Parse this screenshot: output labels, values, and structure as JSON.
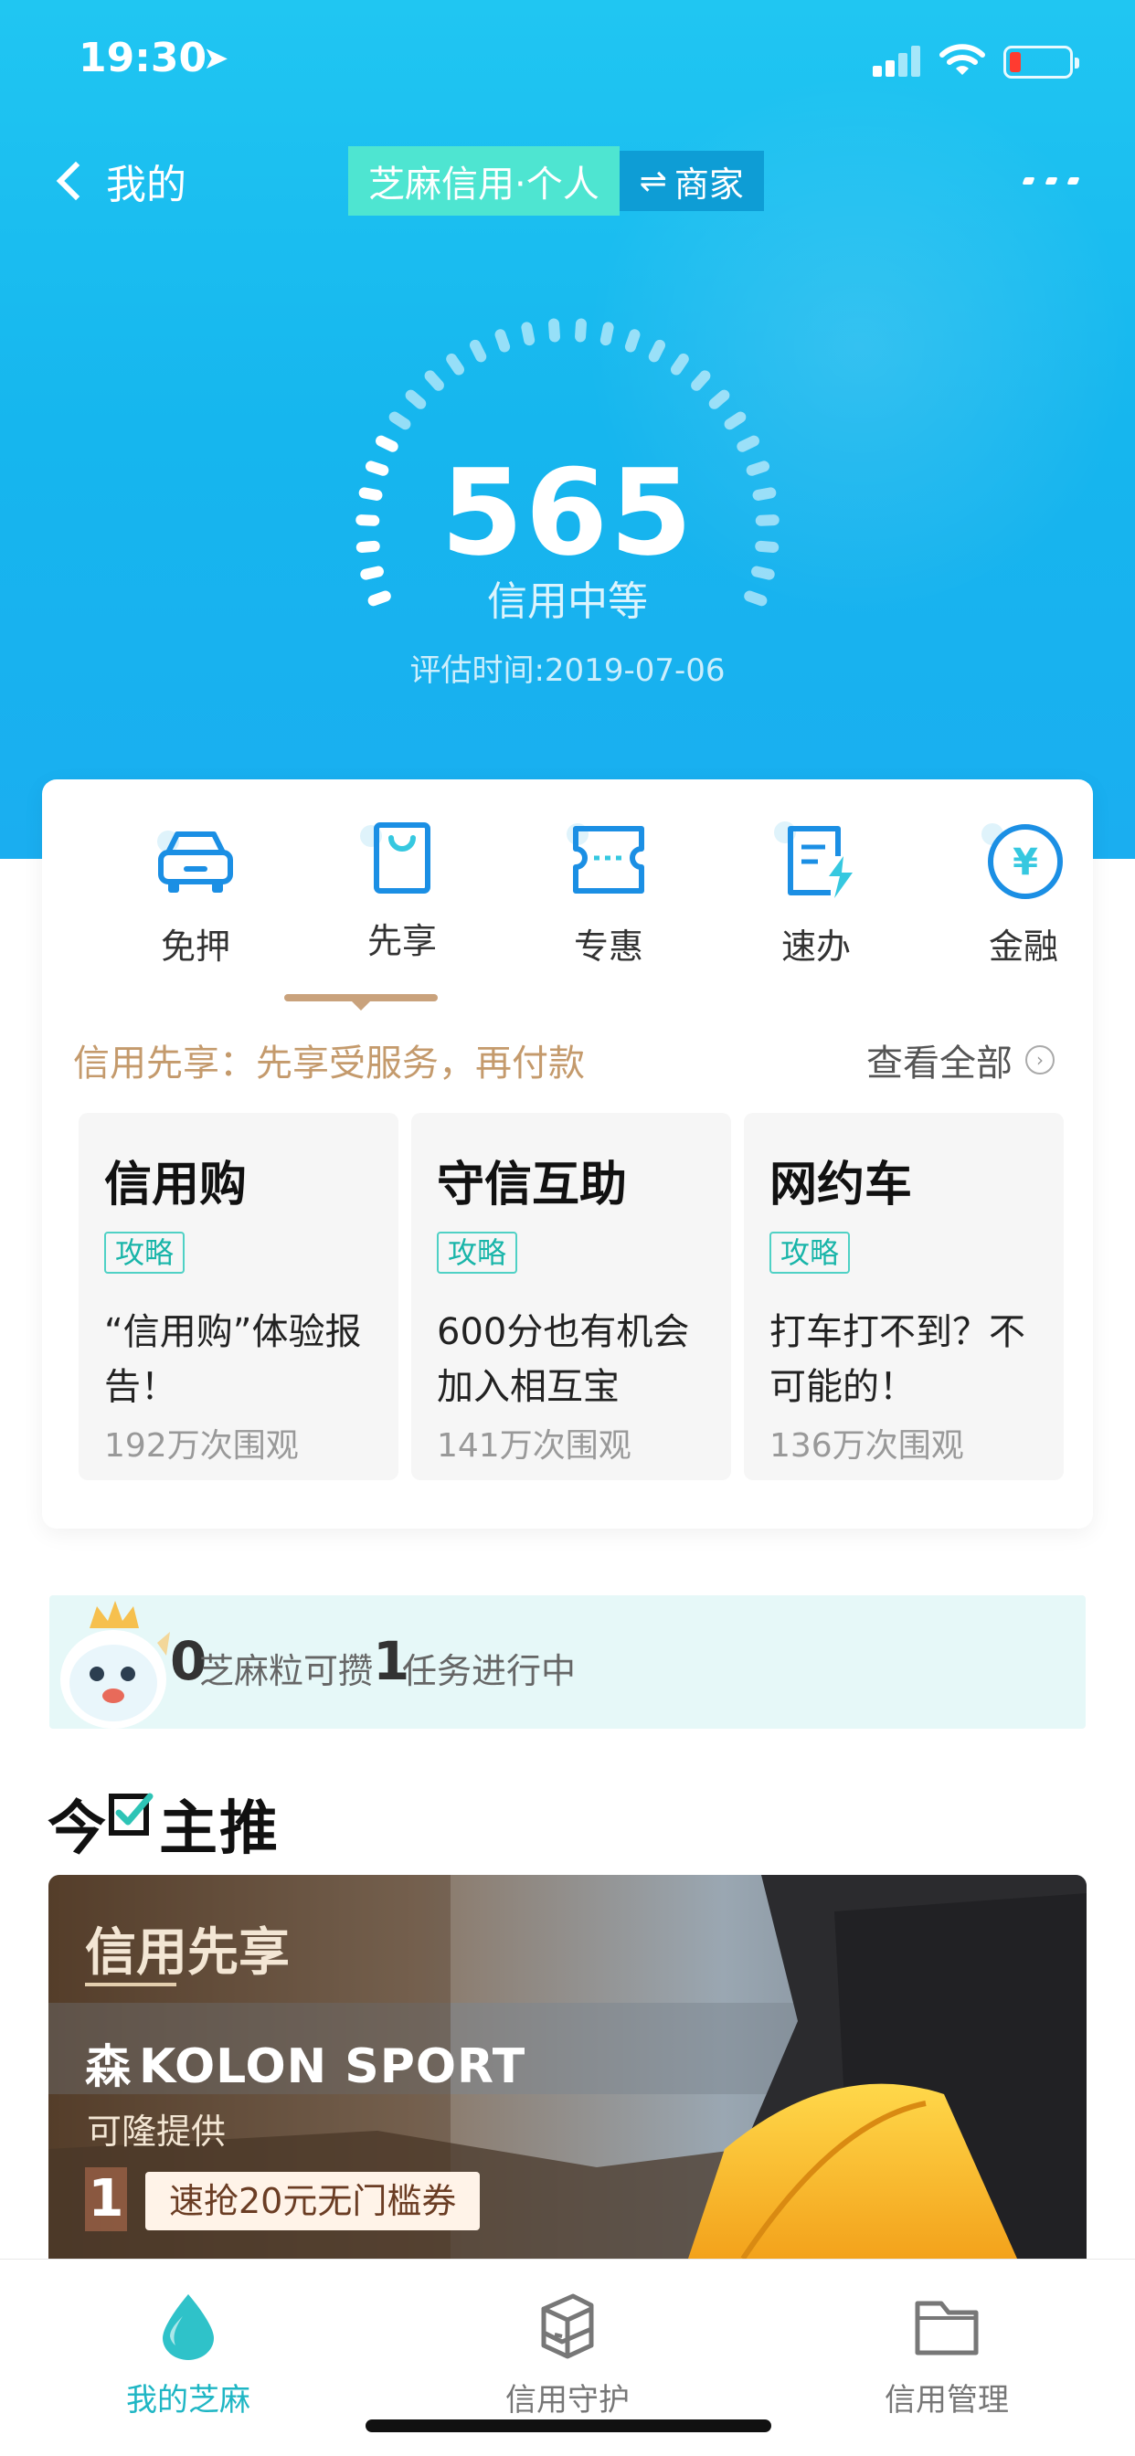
{
  "status_bar": {
    "time": "19:30"
  },
  "nav": {
    "back_label": "我的",
    "current_mode": "芝麻信用·个人",
    "switch_label": "商家"
  },
  "score": {
    "value": "565",
    "level": "信用中等",
    "eval_time": "评估时间:2019-07-06"
  },
  "service_tabs": [
    {
      "label": "免押",
      "icon": "car-icon"
    },
    {
      "label": "先享",
      "icon": "shopping-bag-icon"
    },
    {
      "label": "专惠",
      "icon": "coupon-icon"
    },
    {
      "label": "速办",
      "icon": "fast-document-icon"
    },
    {
      "label": "金融",
      "icon": "yuan-coin-icon"
    }
  ],
  "active_tab": "先享",
  "section": {
    "desc": "信用先享：先享受服务，再付款",
    "view_all": "查看全部"
  },
  "cards": [
    {
      "title": "信用购",
      "tag": "攻略",
      "desc": "“信用购”体验报告！",
      "views": "192万次围观"
    },
    {
      "title": "守信互助",
      "tag": "攻略",
      "desc": "600分也有机会加入相互宝",
      "views": "141万次围观"
    },
    {
      "title": "网约车",
      "tag": "攻略",
      "desc": "打车打不到？不可能的！",
      "views": "136万次围观"
    }
  ],
  "tasks": {
    "sesame_count": "0",
    "sesame_label": "芝麻粒可攒",
    "task_count": "1",
    "task_label": "任务进行中"
  },
  "today": {
    "title_a": "今",
    "title_b": "主推"
  },
  "banner": {
    "title": "信用先享",
    "brand": "KOLON SPORT",
    "brand_mark": "森",
    "provider": "可隆提供",
    "item_number": "1",
    "coupon": "速抢20元无门槛券"
  },
  "bottom_tabs": [
    {
      "label": "我的芝麻",
      "icon": "sesame-drop-icon",
      "active": true
    },
    {
      "label": "信用守护",
      "icon": "shield-icon",
      "active": false
    },
    {
      "label": "信用管理",
      "icon": "folder-icon",
      "active": false
    }
  ],
  "colors": {
    "hero_blue": "#16b6ee",
    "accent_teal": "#4ee5d1",
    "tab_indicator": "#c9a27c",
    "section_text": "#c49a6c",
    "tag_teal": "#19b5a9",
    "active_tab_bar": "#1fb6c4"
  }
}
